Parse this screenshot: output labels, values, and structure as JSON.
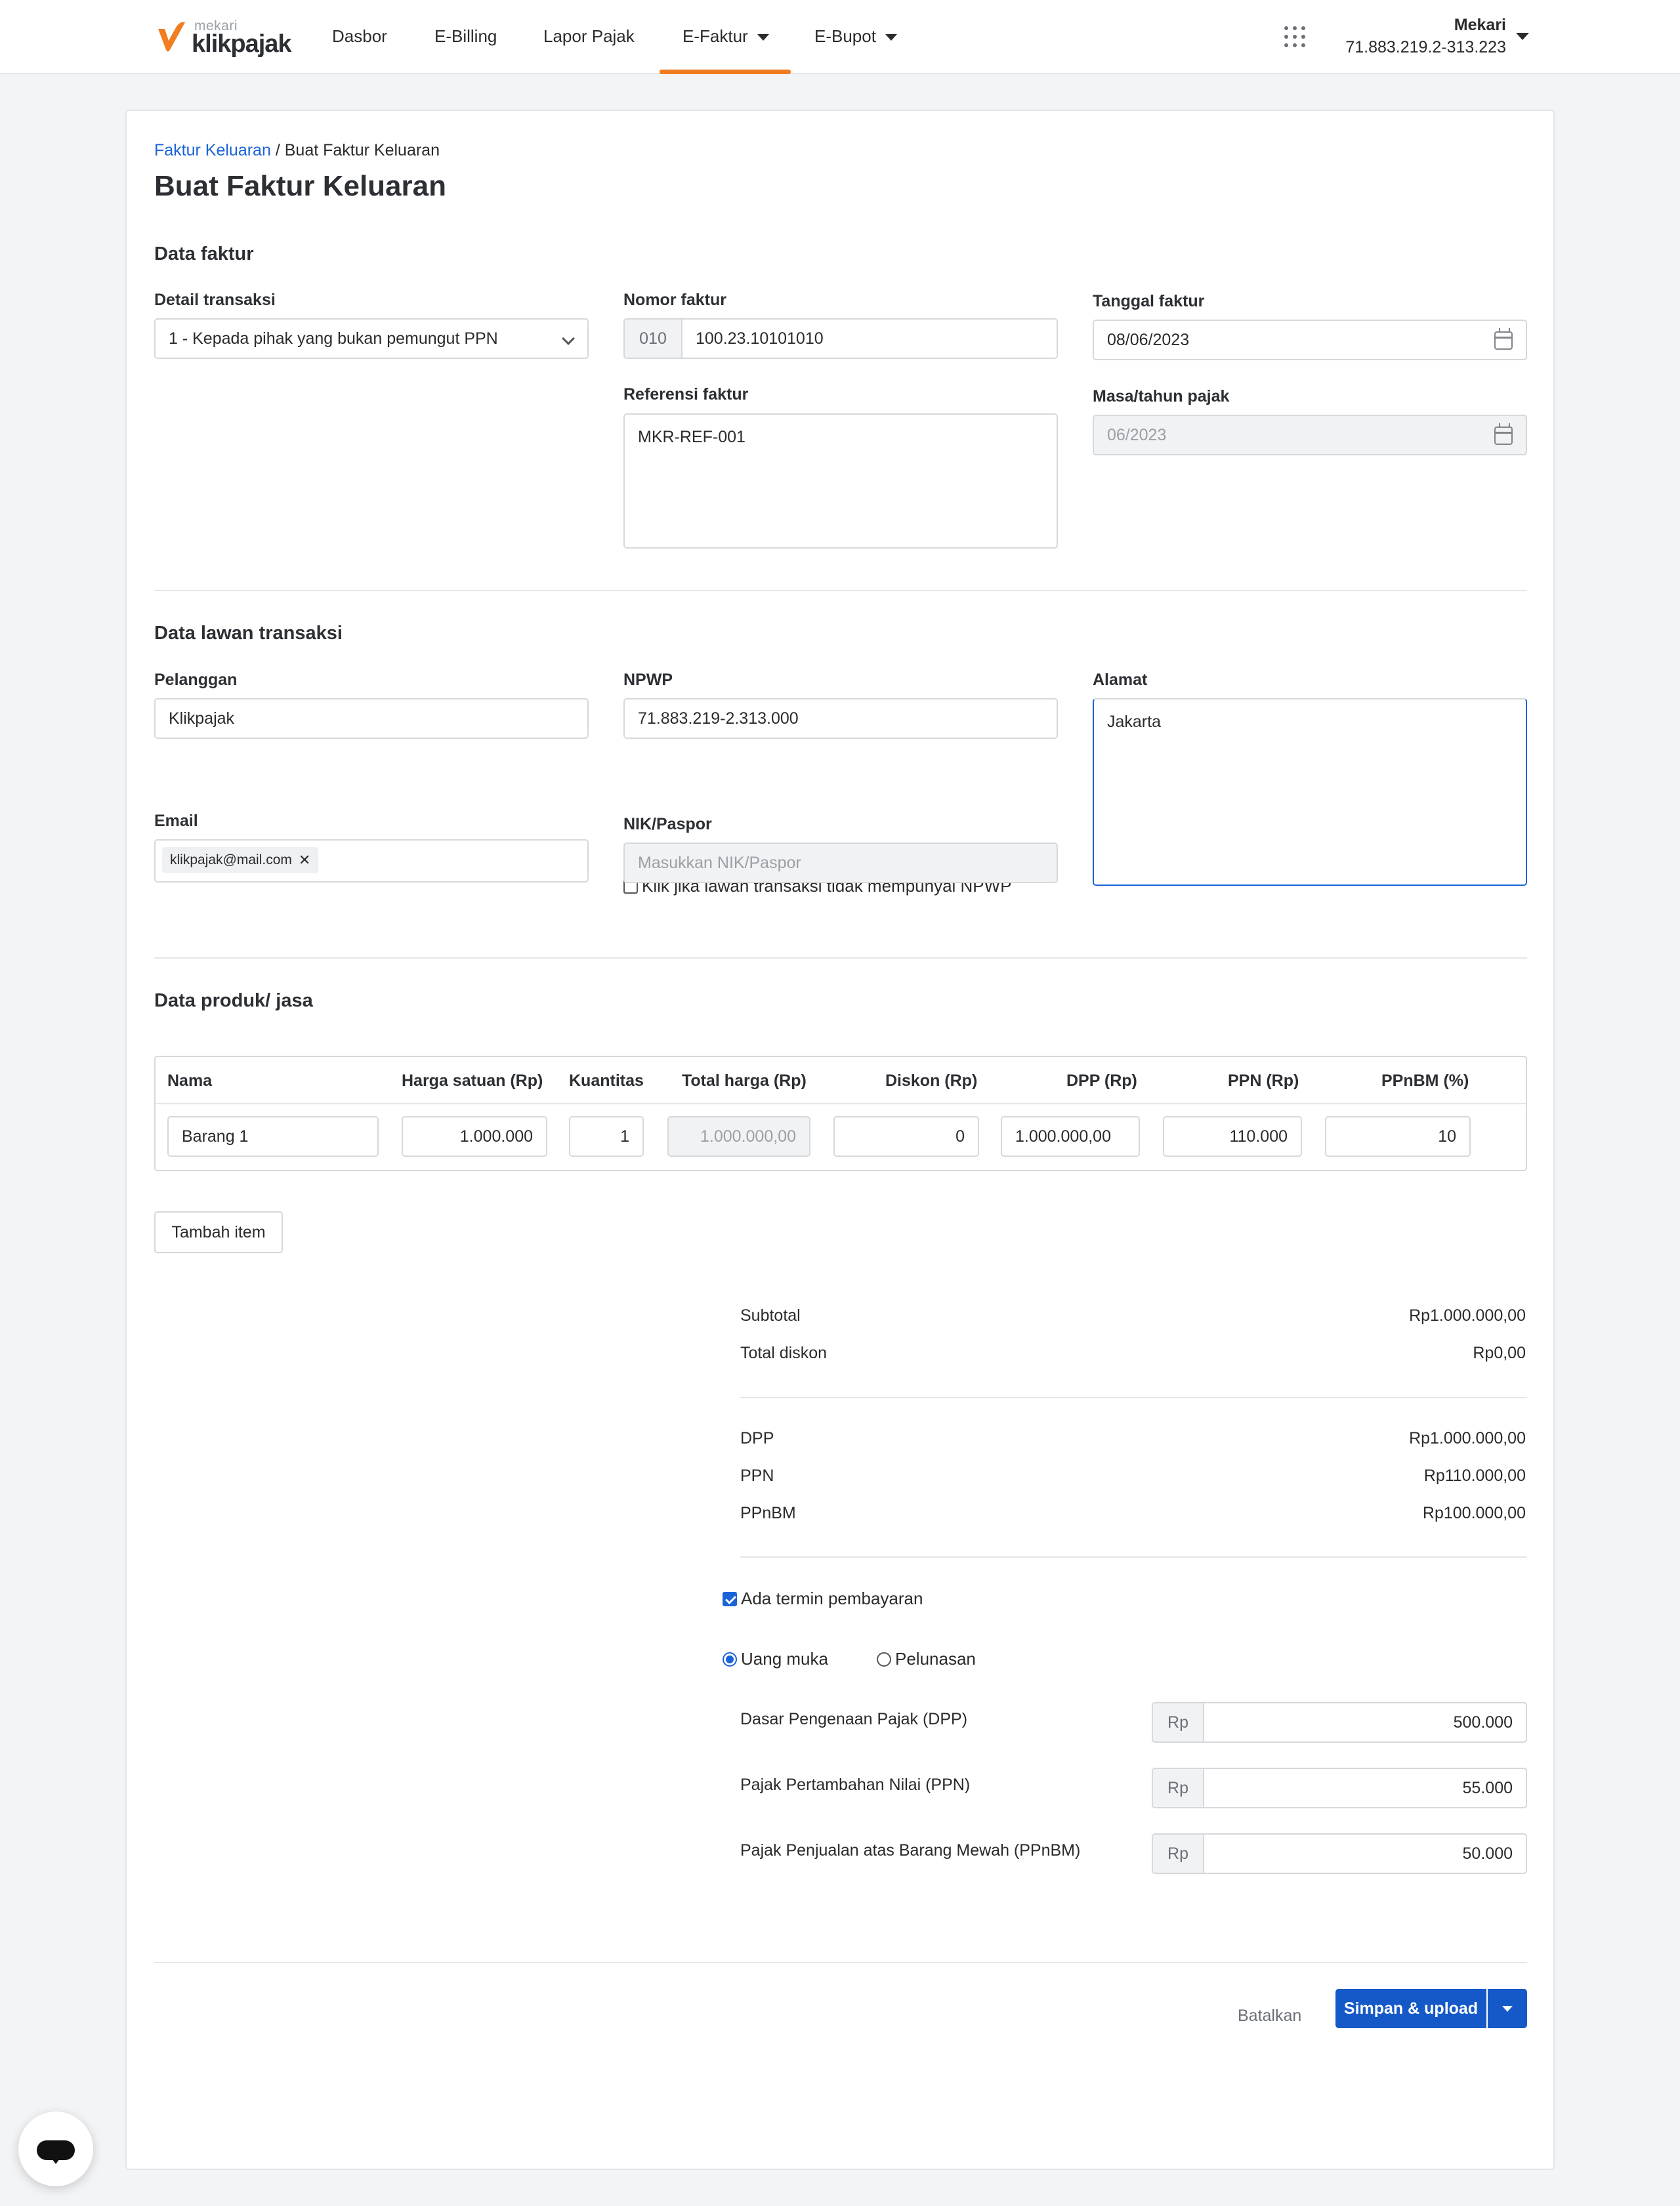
{
  "brand": {
    "small": "mekari",
    "name": "klikpajak",
    "accent": "#f27d20"
  },
  "nav": {
    "items": [
      {
        "label": "Dasbor"
      },
      {
        "label": "E-Billing"
      },
      {
        "label": "Lapor Pajak"
      },
      {
        "label": "E-Faktur",
        "active": true
      },
      {
        "label": "E-Bupot"
      }
    ]
  },
  "account": {
    "name": "Mekari",
    "npwp": "71.883.219.2-313.223"
  },
  "breadcrumb": {
    "parent": "Faktur Keluaran",
    "separator": "/",
    "current": "Buat Faktur Keluaran"
  },
  "page_title": "Buat Faktur Keluaran",
  "data_faktur": {
    "title": "Data faktur",
    "detail_transaksi": {
      "label": "Detail transaksi",
      "value": "1 - Kepada pihak yang bukan pemungut PPN"
    },
    "nomor_faktur": {
      "label": "Nomor faktur",
      "prefix": "010",
      "value": "100.23.10101010"
    },
    "referensi_faktur": {
      "label": "Referensi faktur",
      "value": "MKR-REF-001"
    },
    "tanggal_faktur": {
      "label": "Tanggal faktur",
      "value": "08/06/2023"
    },
    "masa_tahun_pajak": {
      "label": "Masa/tahun pajak",
      "value": "06/2023"
    }
  },
  "data_lawan": {
    "title": "Data lawan transaksi",
    "pelanggan": {
      "label": "Pelanggan",
      "value": "Klikpajak"
    },
    "npwp": {
      "label": "NPWP",
      "value": "71.883.219-2.313.000"
    },
    "no_npwp_checkbox": "Klik jika lawan transaksi tidak mempunyai NPWP",
    "alamat": {
      "label": "Alamat",
      "value": "Jakarta"
    },
    "email": {
      "label": "Email",
      "tag": "klikpajak@mail.com"
    },
    "nik": {
      "label": "NIK/Paspor",
      "placeholder": "Masukkan NIK/Paspor"
    }
  },
  "data_produk": {
    "title": "Data produk/ jasa",
    "columns": [
      "Nama",
      "Harga satuan (Rp)",
      "Kuantitas",
      "Total harga (Rp)",
      "Diskon (Rp)",
      "DPP (Rp)",
      "PPN (Rp)",
      "PPnBM (%)"
    ],
    "rows": [
      {
        "nama": "Barang 1",
        "harga": "1.000.000",
        "kuantitas": "1",
        "total": "1.000.000,00",
        "diskon": "0",
        "dpp": "1.000.000,00",
        "ppn": "110.000",
        "ppnbm": "10"
      }
    ],
    "add_button": "Tambah item"
  },
  "summary": {
    "subtotal": {
      "label": "Subtotal",
      "value": "Rp1.000.000,00"
    },
    "total_diskon": {
      "label": "Total diskon",
      "value": "Rp0,00"
    },
    "dpp": {
      "label": "DPP",
      "value": "Rp1.000.000,00"
    },
    "ppn": {
      "label": "PPN",
      "value": "Rp110.000,00"
    },
    "ppnbm": {
      "label": "PPnBM",
      "value": "Rp100.000,00"
    }
  },
  "termin": {
    "checkbox_label": "Ada termin pembayaran",
    "checked": true,
    "options": [
      {
        "label": "Uang muka",
        "selected": true
      },
      {
        "label": "Pelunasan",
        "selected": false
      }
    ],
    "currency": "Rp",
    "fields": [
      {
        "label": "Dasar Pengenaan Pajak (DPP)",
        "value": "500.000"
      },
      {
        "label": "Pajak Pertambahan Nilai (PPN)",
        "value": "55.000"
      },
      {
        "label": "Pajak Penjualan atas Barang Mewah (PPnBM)",
        "value": "50.000"
      }
    ]
  },
  "actions": {
    "cancel": "Batalkan",
    "primary": "Simpan & upload"
  }
}
